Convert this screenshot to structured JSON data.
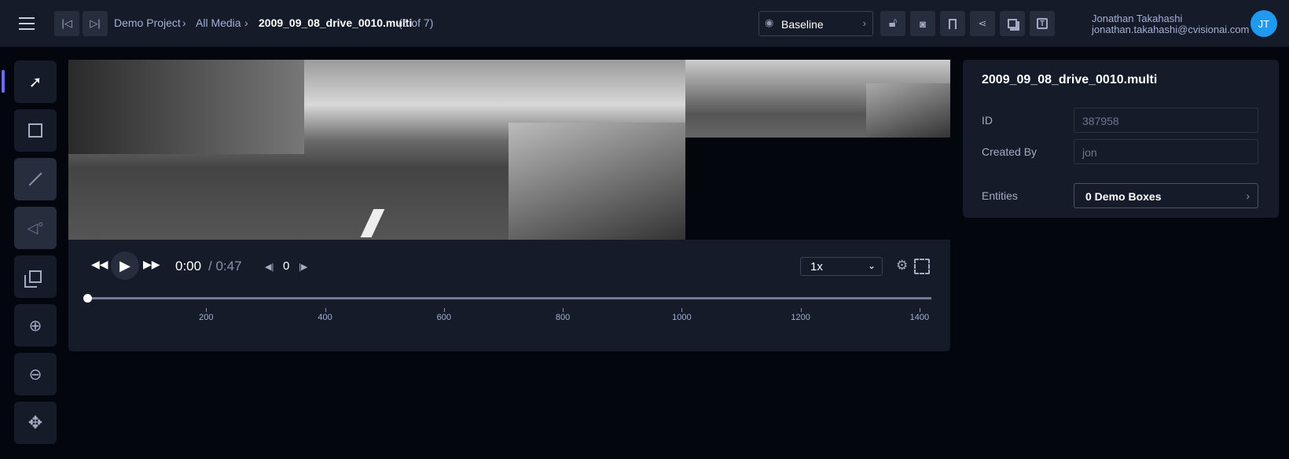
{
  "header": {
    "breadcrumb": {
      "project": "Demo Project",
      "media": "All Media",
      "file": "2009_09_08_drive_0010.multi",
      "position": "(5 of 7)"
    },
    "version_selector": "Baseline",
    "user": {
      "name": "Jonathan Takahashi",
      "email": "jonathan.takahashi@cvisionai.com",
      "initials": "JT"
    },
    "accent": "#1e9bf0"
  },
  "toolbar": [
    "select",
    "box",
    "line",
    "poly",
    "multi",
    "zoom-in",
    "zoom-out",
    "pan"
  ],
  "player": {
    "current_time": "0:00",
    "total_time": "/ 0:47",
    "frame": "0",
    "speed": "1x",
    "timeline_max": 1420,
    "timeline_progress": 0,
    "ticks": [
      "200",
      "400",
      "600",
      "800",
      "1000",
      "1200",
      "1400"
    ]
  },
  "details": {
    "title": "2009_09_08_drive_0010.multi",
    "id_label": "ID",
    "id_value": "387958",
    "created_label": "Created By",
    "created_value": "jon",
    "entities_label": "Entities",
    "entities_value": "0 Demo Boxes"
  }
}
